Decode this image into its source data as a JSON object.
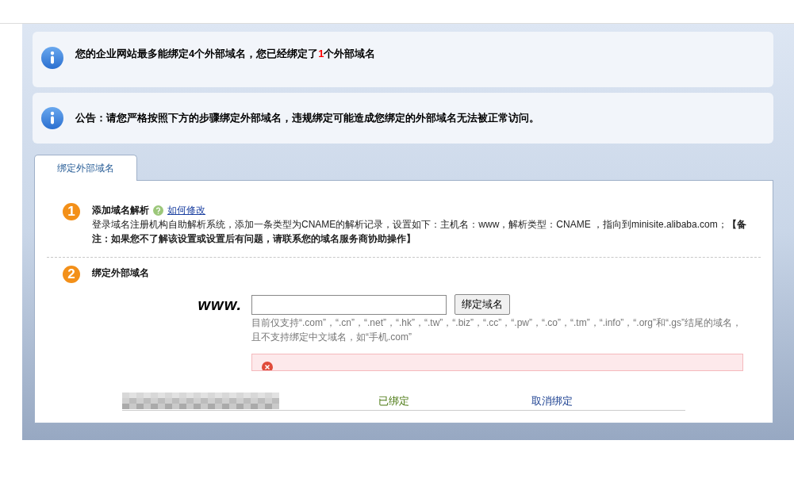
{
  "notices": [
    {
      "parts": [
        {
          "text": "您的企业网站最多能绑定4个外部域名，您已经绑定了",
          "kind": "plain"
        },
        {
          "text": "1",
          "kind": "count"
        },
        {
          "text": "个外部域名",
          "kind": "plain"
        }
      ]
    },
    {
      "parts": [
        {
          "text": "公告：请您严格按照下方的步骤绑定外部域名，违规绑定可能造成您绑定的外部域名无法被正常访问。",
          "kind": "plain"
        }
      ]
    }
  ],
  "tabs": [
    {
      "label": "绑定外部域名",
      "selected": true
    }
  ],
  "steps": [
    {
      "number": "1",
      "title": "添加域名解析",
      "link": "如何修改",
      "description": "登录域名注册机构自助解析系统，添加一条类型为CNAME的解析记录，设置如下：主机名：www，解析类型：CNAME ，指向到minisite.alibaba.com；",
      "note": "【备注：如果您不了解该设置或设置后有问题，请联系您的域名服务商协助操作】"
    },
    {
      "number": "2",
      "title": "绑定外部域名"
    }
  ],
  "bind_form": {
    "prefix": "www.",
    "button": "绑定域名",
    "hint": "目前仅支持“.com”，“.cn”，“.net”，“.hk”，“.tw”，“.biz”，“.cc”，“.pw”，“.co”，“.tm”，“.info”，“.org”和“.gs”结尾的域名，且不支持绑定中文域名，如“手机.com”"
  },
  "bound_domains": [
    {
      "status": "已绑定",
      "action": "取消绑定"
    }
  ]
}
